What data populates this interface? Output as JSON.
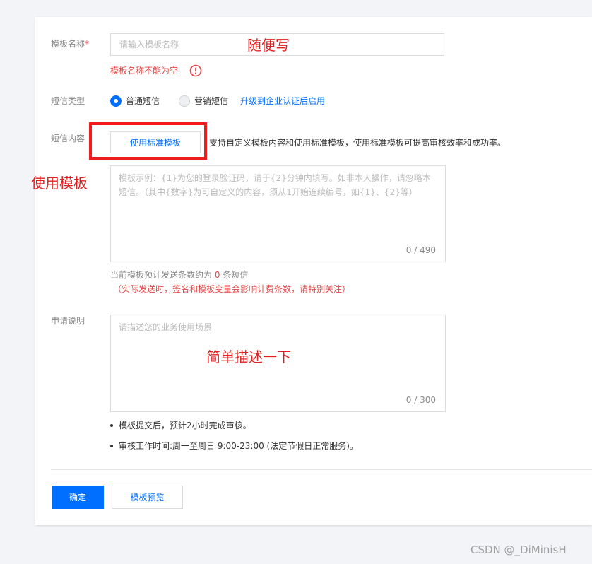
{
  "form": {
    "name_label": "模板名称",
    "required_mark": "*",
    "name_placeholder": "请输入模板名称",
    "name_error": "模板名称不能为空",
    "type_label": "短信类型",
    "type_options": [
      "普通短信",
      "营销短信"
    ],
    "type_selected": "普通短信",
    "upgrade_link": "升级到企业认证后启用",
    "content_label": "短信内容",
    "use_template_button": "使用标准模板",
    "content_hint": "支持自定义模板内容和使用标准模板，使用标准模板可提高审核效率和成功率。",
    "content_placeholder": "模板示例：{1}为您的登录验证码，请于{2}分钟内填写。如非本人操作，请忽略本短信。（其中{数字}为可自定义的内容，须从1开始连续编号，如{1}、{2}等）",
    "content_counter": "0 / 490",
    "estimate_prefix": "当前模板预计发送条数约为",
    "estimate_count": "0",
    "estimate_suffix": "条短信",
    "estimate_note": "（实际发送时，签名和模板变量会影响计费条数，请特别关注）",
    "apply_label": "申请说明",
    "apply_placeholder": "请描述您的业务使用场景",
    "apply_counter": "0 / 300",
    "notes": [
      "模板提交后，预计2小时完成审核。",
      "审核工作时间:周一至周日 9:00-23:00 (法定节假日正常服务)。"
    ],
    "confirm_button": "确定",
    "preview_button": "模板预览"
  },
  "annotations": {
    "name_note": "随便写",
    "template_note": "使用模板",
    "apply_note": "简单描述一下"
  },
  "watermark": "CSDN @_DiMinisH",
  "colors": {
    "primary": "#006eff",
    "error": "#e54545",
    "annotation": "#e02020",
    "annotation_box": "#ee1c1c"
  }
}
